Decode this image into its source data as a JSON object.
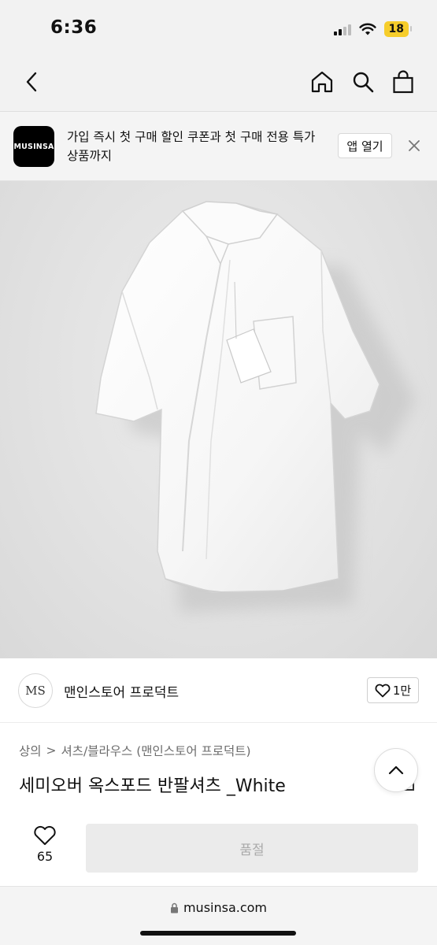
{
  "status": {
    "time": "6:36",
    "battery": "18"
  },
  "nav": {
    "back_icon": "chevron-left-icon",
    "home_icon": "home-icon",
    "search_icon": "search-icon",
    "cart_icon": "shopping-bag-icon"
  },
  "banner": {
    "logo_text": "MUSINSA",
    "message": "가입 즉시 첫 구매 할인 쿠폰과 첫 구매 전용 특가 상품까지",
    "open_app_label": "앱 열기",
    "close_icon": "close-icon"
  },
  "brand": {
    "logo_text": "MS",
    "name": "맨인스토어 프로덕트",
    "like_count": "1만"
  },
  "breadcrumb": {
    "category": "상의",
    "separator": ">",
    "subcategory": "셔츠/블라우스 (맨인스토어 프로덕트)"
  },
  "product": {
    "title": "세미오버 옥스포드 반팔셔츠 _White"
  },
  "purchase": {
    "wish_count": "65",
    "button_label": "품절"
  },
  "browser": {
    "url": "musinsa.com"
  },
  "colors": {
    "background": "#f2f2f2",
    "soldout_bg": "#ebebeb",
    "soldout_text": "#aaaaaa",
    "battery": "#f6cd2b"
  }
}
